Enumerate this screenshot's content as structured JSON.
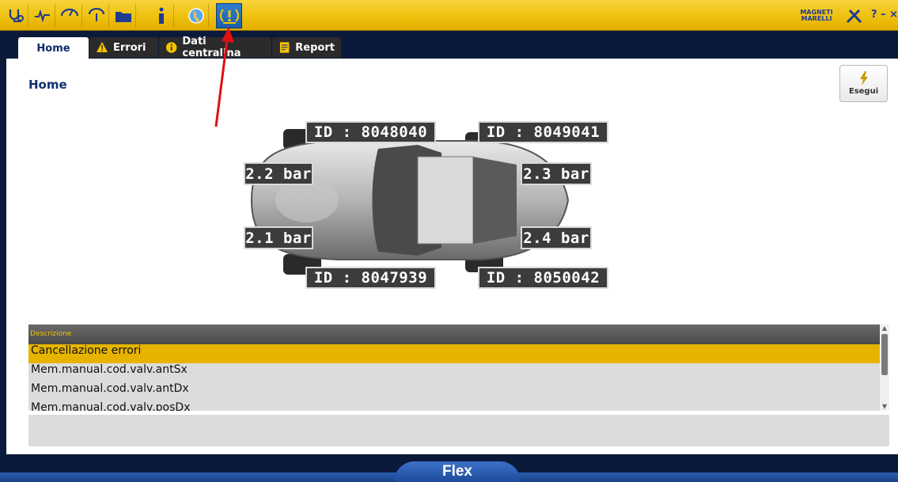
{
  "toolbar": {
    "icons": [
      "stethoscope-icon",
      "heartbeat-icon",
      "gauge-icon",
      "folder-icon",
      "info-icon",
      "globe-icon",
      "tpms-warning-icon"
    ],
    "brand": "MAGNETI MARELLI",
    "right_text": "? – ×"
  },
  "tabs": [
    {
      "label": "Home",
      "icon": "home"
    },
    {
      "label": "Errori",
      "icon": "warning-icon"
    },
    {
      "label": "Dati centralina",
      "icon": "info-circle-icon"
    },
    {
      "label": "Report",
      "icon": "report-icon"
    }
  ],
  "page": {
    "title": "Home",
    "execute_label": "Esegui"
  },
  "tpms": {
    "id_front_left": "ID : 8048040",
    "id_front_right": "ID : 8049041",
    "id_rear_left": "ID : 8047939",
    "id_rear_right": "ID : 8050042",
    "p_front_left": "2.2 bar",
    "p_front_right": "2.3 bar",
    "p_rear_left": "2.1 bar",
    "p_rear_right": "2.4 bar"
  },
  "list": {
    "header": "Descrizione",
    "rows": [
      "Cancellazione errori",
      "Mem.manual.cod.valv.antSx",
      "Mem.manual.cod.valv.antDx",
      "Mem.manual.cod.valv.posDx"
    ]
  },
  "footer": {
    "label": "Flex"
  },
  "colors": {
    "toolbar_yellow": "#efc20f",
    "selection": "#e6b400",
    "title_blue": "#10306e",
    "arrow_red": "#e01010"
  }
}
